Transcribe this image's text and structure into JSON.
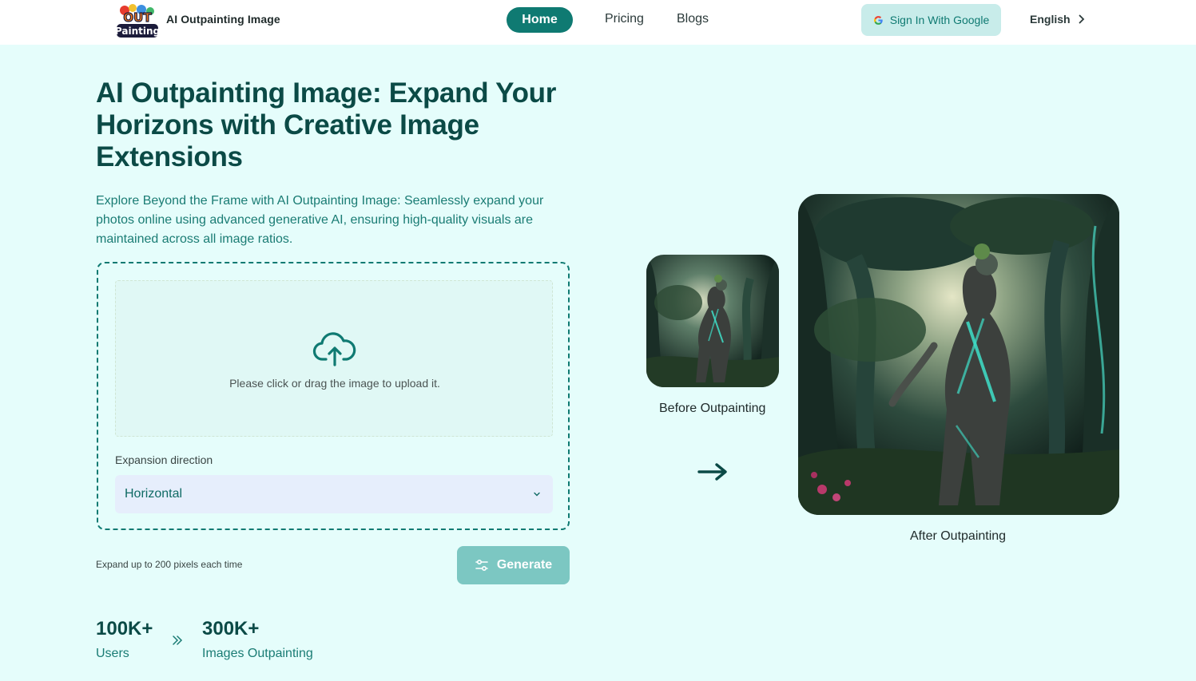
{
  "header": {
    "logo_text_top": "OUT",
    "logo_text_bottom": "Painting",
    "brand": "AI Outpainting Image",
    "nav": {
      "home": "Home",
      "pricing": "Pricing",
      "blogs": "Blogs"
    },
    "signin_label": "Sign In With Google",
    "language": "English"
  },
  "hero": {
    "title": "AI Outpainting Image: Expand Your Horizons with Creative Image Extensions",
    "description": "Explore Beyond the Frame with AI Outpainting Image: Seamlessly expand your photos online using advanced generative AI, ensuring high-quality visuals are maintained across all image ratios."
  },
  "upload": {
    "dropzone_text": "Please click or drag the image to upload it.",
    "expansion_label": "Expansion direction",
    "expansion_value": "Horizontal",
    "hint": "Expand up to 200 pixels each time",
    "generate_label": "Generate"
  },
  "stats": [
    {
      "value": "100K+",
      "label": "Users"
    },
    {
      "value": "300K+",
      "label": "Images Outpainting"
    }
  ],
  "examples": {
    "before_caption": "Before Outpainting",
    "after_caption": "After Outpainting"
  },
  "colors": {
    "primary": "#0f7a72",
    "page_bg": "#e5fdfb",
    "generate_bg": "#7cc7c2",
    "select_bg": "#e6eefc"
  }
}
